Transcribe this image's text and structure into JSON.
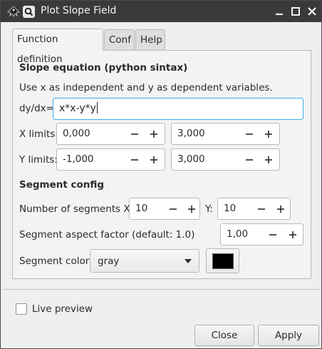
{
  "window": {
    "title": "Plot Slope Field",
    "colors": {
      "titlebar": "#3a3a3a",
      "focus_border": "#3daee9",
      "segment_color_swatch": "#000000"
    },
    "controls": [
      "minimize-icon",
      "maximize-icon",
      "close-icon"
    ]
  },
  "tabs": [
    {
      "label": "Function definition",
      "active": true
    },
    {
      "label": "Conf",
      "active": false
    },
    {
      "label": "Help",
      "active": false
    }
  ],
  "slope": {
    "heading": "Slope equation (python sintax)",
    "description": "Use x as independent and y as dependent variables.",
    "dydx_label": "dy/dx=",
    "equation": "x*x-y*y"
  },
  "limits": {
    "x_label": "X limits:",
    "x_min": "0,000",
    "x_max": "3,000",
    "y_label": "Y limits:",
    "y_min": "-1,000",
    "y_max": "3,000"
  },
  "segment": {
    "heading": "Segment config",
    "number_label": "Number of segments  X:",
    "x_segments": "10",
    "y_label": "Y:",
    "y_segments": "10",
    "aspect_label": "Segment aspect factor (default: 1.0)",
    "aspect_value": "1,00",
    "color_label": "Segment color:",
    "color_value": "gray"
  },
  "footer": {
    "live_preview_label": "Live preview",
    "live_preview_checked": false,
    "close_label": "Close",
    "apply_label": "Apply"
  }
}
